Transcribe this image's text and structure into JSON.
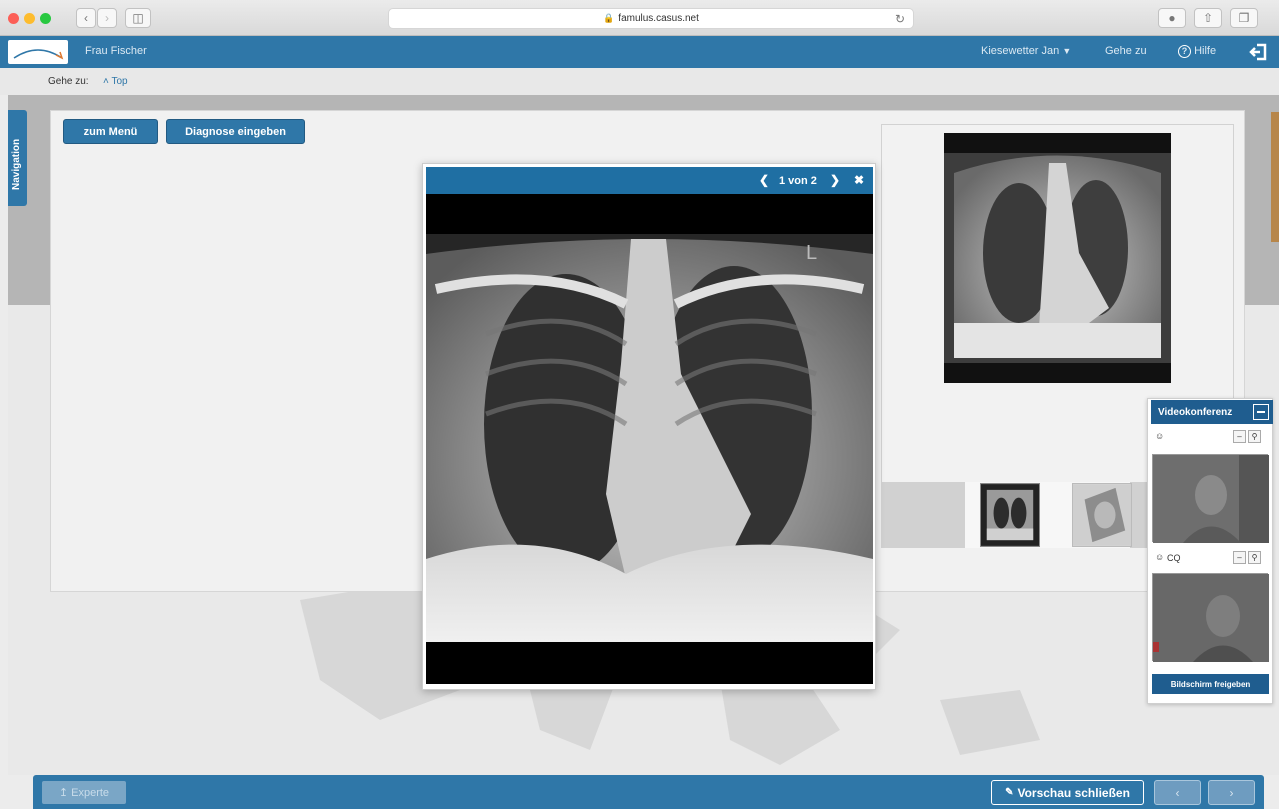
{
  "browser": {
    "url": "famulus.casus.net"
  },
  "header": {
    "patient": "Frau Fischer",
    "user": "Kiesewetter Jan",
    "goto": "Gehe zu",
    "help": "Hilfe"
  },
  "subbar": {
    "goto_label": "Gehe zu:",
    "top_link": "Top"
  },
  "sidebar": {
    "navigation_label": "Navigation"
  },
  "toolbar": {
    "menu_button": "zum Menü",
    "diagnosis_button": "Diagnose eingeben"
  },
  "viewer": {
    "counter": "1 von 2"
  },
  "video_conference": {
    "title": "Videokonferenz",
    "participant_2_name": "CQ",
    "share_button": "Bildschirm freigeben"
  },
  "footer": {
    "expert_button": "Experte",
    "close_preview_button": "Vorschau schließen"
  },
  "colors": {
    "primary": "#2f77a8",
    "dark": "#1f5d8f"
  }
}
